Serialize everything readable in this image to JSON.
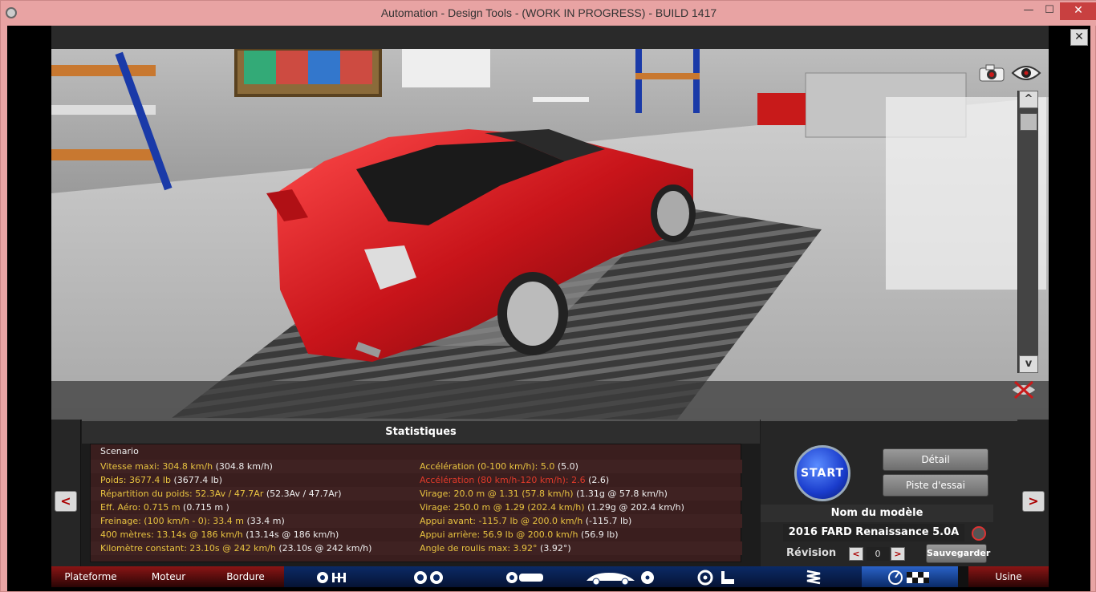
{
  "window": {
    "title": "Automation - Design Tools - (WORK IN PROGRESS) - BUILD 1417",
    "min": "—",
    "max": "☐",
    "close": "✕"
  },
  "viewport": {
    "close": "✕",
    "scroll_up": "^",
    "scroll_down": "v",
    "car_color": "#c8141a"
  },
  "stats": {
    "header": "Statistiques",
    "scenario": "Scenario",
    "left": [
      {
        "label": "Vitesse maxi: 304.8 km/h",
        "paren": "(304.8 km/h)",
        "color": "y"
      },
      {
        "label": "Poids: 3677.4 lb",
        "paren": "(3677.4 lb)",
        "color": "y"
      },
      {
        "label": "Répartition du poids: 52.3Av / 47.7Ar",
        "paren": "(52.3Av / 47.7Ar)",
        "color": "y"
      },
      {
        "label": "Eff. Aéro: 0.715 m",
        "paren": " (0.715 m )",
        "color": "y"
      },
      {
        "label": "Freinage: (100 km/h - 0): 33.4 m",
        "paren": " (33.4 m)",
        "color": "y"
      },
      {
        "label": "400 mètres: 13.14s @ 186 km/h",
        "paren": "(13.14s @ 186 km/h)",
        "color": "y"
      },
      {
        "label": "Kilomètre constant: 23.10s @ 242 km/h",
        "paren": "(23.10s @ 242 km/h)",
        "color": "y"
      }
    ],
    "right": [
      {
        "label": "Accélération (0-100 km/h): 5.0",
        "paren": "(5.0)",
        "color": "y"
      },
      {
        "label": "Accélération (80 km/h-120 km/h): 2.6",
        "paren": "(2.6)",
        "color": "r"
      },
      {
        "label": "Virage: 20.0 m @ 1.31 (57.8 km/h)",
        "paren": "(1.31g @ 57.8 km/h)",
        "color": "y"
      },
      {
        "label": "Virage: 250.0 m @ 1.29 (202.4 km/h)",
        "paren": "(1.29g @ 202.4 km/h)",
        "color": "y"
      },
      {
        "label": "Appui avant: -115.7 lb @ 200.0 km/h",
        "paren": "(-115.7 lb)",
        "color": "y"
      },
      {
        "label": "Appui arrière: 56.9 lb @ 200.0 km/h",
        "paren": "(56.9 lb)",
        "color": "y"
      },
      {
        "label": "Angle de roulis max: 3.92°",
        "paren": "(3.92°)",
        "color": "y"
      }
    ]
  },
  "nav": {
    "left": "<",
    "right": ">"
  },
  "panel": {
    "start": "START",
    "detail": "Détail",
    "test_track": "Piste d'essai",
    "model_name_header": "Nom du modèle",
    "model_name": "2016 FARD Renaissance 5.0A",
    "revision_label": "Révision",
    "revision_value": "0",
    "rev_prev": "<",
    "rev_next": ">",
    "save": "Sauvegarder"
  },
  "tabs": {
    "plateforme": "Plateforme",
    "moteur": "Moteur",
    "bordure": "Bordure",
    "usine": "Usine"
  }
}
